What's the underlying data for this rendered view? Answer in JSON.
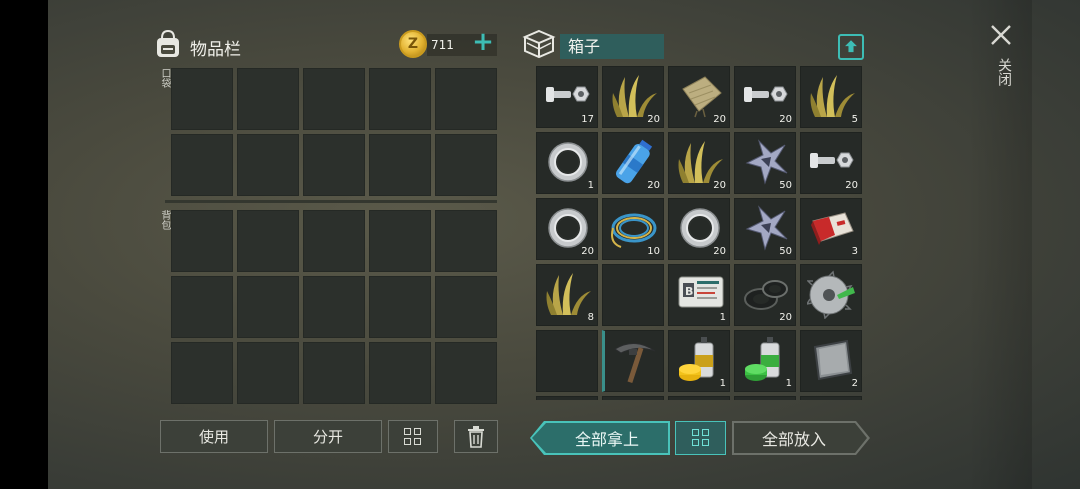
{
  "inventory": {
    "title": "物品栏",
    "pocket_label": "口袋",
    "bag_label": "背包",
    "coins": "711",
    "coin_symbol": "Z",
    "add_label": "+"
  },
  "container": {
    "name": "箱子",
    "items": [
      {
        "icon": "bolt-nut-icon",
        "qty": "17"
      },
      {
        "icon": "plant-fiber-icon",
        "qty": "20"
      },
      {
        "icon": "cloth-scrap-icon",
        "qty": "20"
      },
      {
        "icon": "bolt-nut-icon",
        "qty": "20"
      },
      {
        "icon": "plant-fiber-icon",
        "qty": "5"
      },
      {
        "icon": "bearing-ring-icon",
        "qty": "1"
      },
      {
        "icon": "water-bottle-icon",
        "qty": "20"
      },
      {
        "icon": "plant-fiber-icon",
        "qty": "20"
      },
      {
        "icon": "metal-scrap-icon",
        "qty": "50"
      },
      {
        "icon": "bolt-nut-icon",
        "qty": "20"
      },
      {
        "icon": "bearing-ring-icon",
        "qty": "20"
      },
      {
        "icon": "wire-coil-icon",
        "qty": "10"
      },
      {
        "icon": "bearing-ring-icon",
        "qty": "20"
      },
      {
        "icon": "metal-scrap-icon",
        "qty": "50"
      },
      {
        "icon": "cigarette-pack-icon",
        "qty": "3"
      },
      {
        "icon": "plant-fiber-icon",
        "qty": "8"
      },
      {
        "icon": "empty-slot",
        "qty": ""
      },
      {
        "icon": "id-card-icon",
        "qty": "1"
      },
      {
        "icon": "rubber-seal-icon",
        "qty": "20"
      },
      {
        "icon": "saw-blade-icon",
        "qty": ""
      },
      {
        "icon": "empty-slot",
        "qty": ""
      },
      {
        "icon": "pickaxe-icon",
        "qty": ""
      },
      {
        "icon": "spray-can-yellow-icon",
        "qty": "1"
      },
      {
        "icon": "spray-can-green-icon",
        "qty": "1"
      },
      {
        "icon": "metal-plate-icon",
        "qty": "2"
      }
    ]
  },
  "buttons": {
    "use": "使用",
    "split": "分开",
    "take_all": "全部拿上",
    "put_all": "全部放入"
  },
  "close": {
    "label": "关闭"
  },
  "colors": {
    "accent": "#3dbdb5",
    "accent_dark": "#2c6e6a",
    "coin": "#e2b230"
  }
}
